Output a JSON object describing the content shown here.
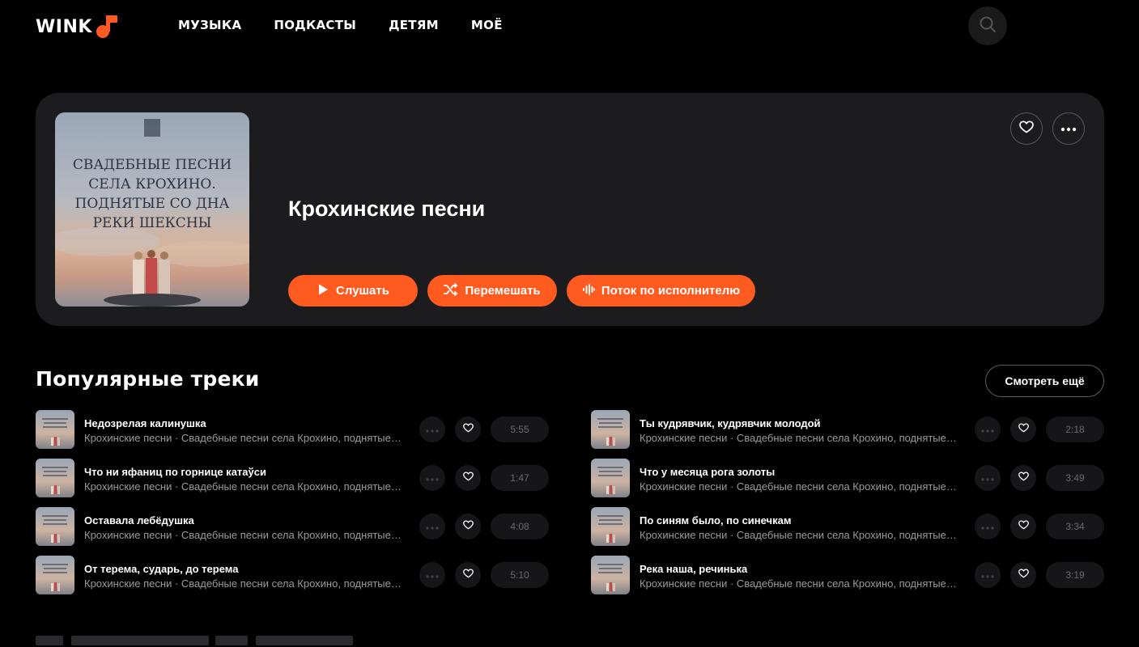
{
  "header": {
    "logo_text": "WINK",
    "nav": [
      "МУЗЫКА",
      "ПОДКАСТЫ",
      "ДЕТЯМ",
      "МОЁ"
    ],
    "search_icon": "search-icon"
  },
  "hero": {
    "cover_text": "Свадебные песни села Крохино, поднятые со дна реки Шексны",
    "title": "Крохинские песни",
    "buttons": {
      "play": "Слушать",
      "shuffle": "Перемешать",
      "stream": "Поток по исполнителю"
    }
  },
  "popular": {
    "title": "Популярные треки",
    "see_more": "Смотреть ещё",
    "left": [
      {
        "title": "Недозрелая калинушка",
        "subtitle": "Крохинские песни · Свадебные песни села Крохино, поднятые со дна реки Шексны",
        "duration": "5:55"
      },
      {
        "title": "Что ни яфаниц по горнице катаўси",
        "subtitle": "Крохинские песни · Свадебные песни села Крохино, поднятые со дна реки Шексны",
        "duration": "1:47"
      },
      {
        "title": "Оставала лебёдушка",
        "subtitle": "Крохинские песни · Свадебные песни села Крохино, поднятые со дна реки Шексны",
        "duration": "4:08"
      },
      {
        "title": "От терема, сударь, до терема",
        "subtitle": "Крохинские песни · Свадебные песни села Крохино, поднятые со дна реки Шексны",
        "duration": "5:10"
      }
    ],
    "right": [
      {
        "title": "Ты кудрявчик, кудрявчик молодой",
        "subtitle": "Крохинские песни · Свадебные песни села Крохино, поднятые со дна реки Шексны",
        "duration": "2:18"
      },
      {
        "title": "Что у месяца рога золоты",
        "subtitle": "Крохинские песни · Свадебные песни села Крохино, поднятые со дна реки Шексны",
        "duration": "3:49"
      },
      {
        "title": "По синям было, по синечкам",
        "subtitle": "Крохинские песни · Свадебные песни села Крохино, поднятые со дна реки Шексны",
        "duration": "3:34"
      },
      {
        "title": "Река наша, речинька",
        "subtitle": "Крохинские песни · Свадебные песни села Крохино, поднятые со дна реки Шексны",
        "duration": "3:19"
      }
    ]
  },
  "colors": {
    "accent": "#ff5a1f",
    "background": "#000000",
    "card": "#1c1c1e",
    "muted_text": "#9a9a9e"
  }
}
